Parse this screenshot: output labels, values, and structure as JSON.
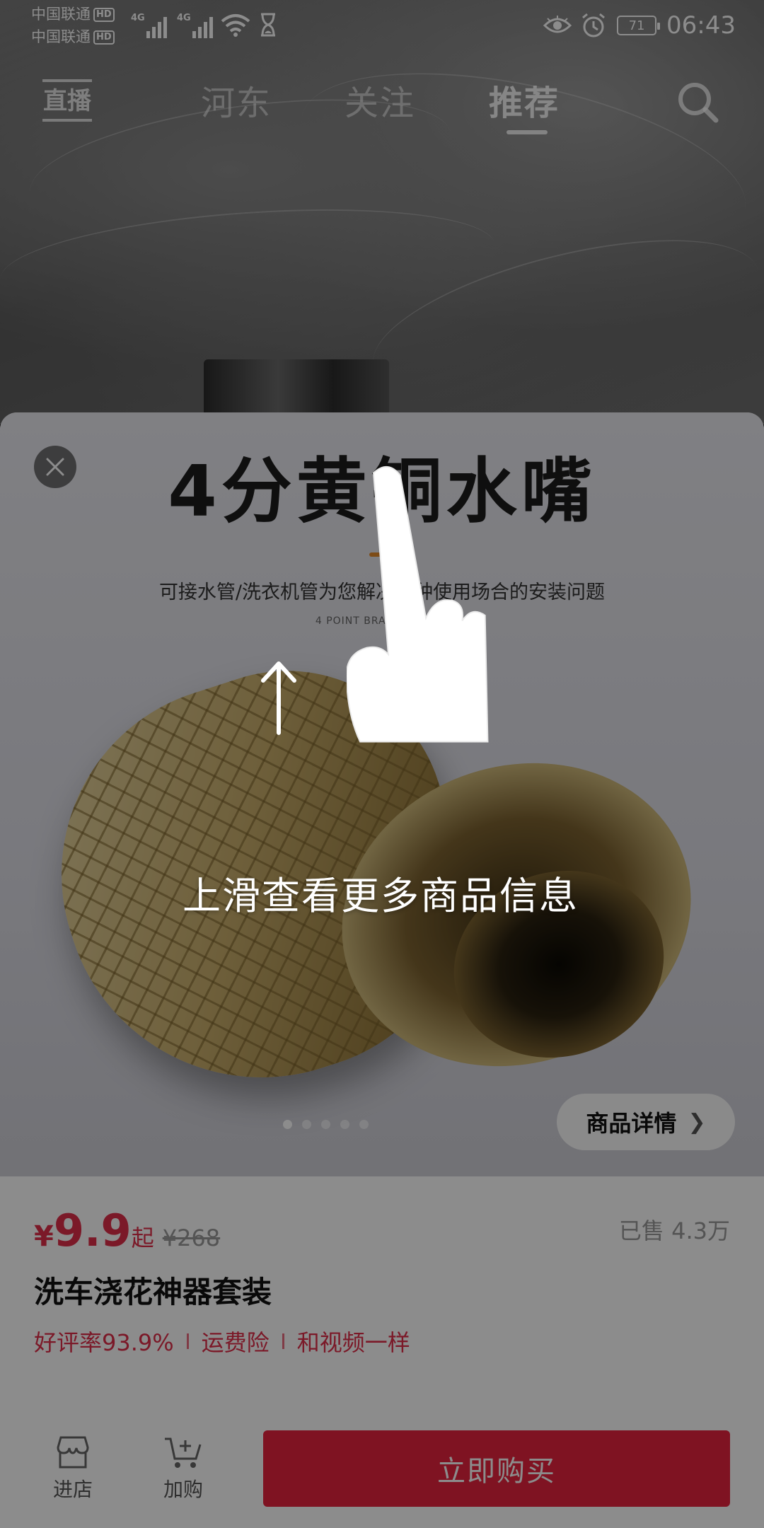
{
  "status_bar": {
    "carrier1": "中国联通",
    "carrier2": "中国联通",
    "hd_badge": "HD",
    "network1": "4G",
    "network2": "4G",
    "battery": "71",
    "time": "06:43"
  },
  "top_nav": {
    "live_label": "直播",
    "tabs": [
      {
        "label": "河东"
      },
      {
        "label": "关注"
      },
      {
        "label": "推荐"
      }
    ],
    "active_tab": "推荐"
  },
  "product": {
    "image_title": "4分黄铜水嘴",
    "image_subtitle": "可接水管/洗衣机管为您解决各种使用场合的安装问题",
    "image_english": "4 POINT BRASS NOZZLE",
    "carousel_count": 5,
    "carousel_active": 1,
    "detail_button": "商品详情",
    "price_symbol": "¥",
    "price": "9.9",
    "price_suffix": "起",
    "original_price": "¥268",
    "sold": "已售 4.3万",
    "name": "洗车浇花神器套装",
    "tags": [
      "好评率93.9%",
      "运费险",
      "和视频一样"
    ]
  },
  "bottom_bar": {
    "store_label": "进店",
    "cart_label": "加购",
    "buy_label": "立即购买"
  },
  "guide": {
    "text": "上滑查看更多商品信息"
  },
  "colors": {
    "accent_red": "#e8233e",
    "price_red": "#e02e4a",
    "nozzle_accent": "#e48a2b"
  },
  "icons": {
    "close": "close-icon",
    "search": "search-icon",
    "store": "store-icon",
    "cart": "cart-add-icon",
    "chevron": "chevron-right-icon",
    "hand": "pointing-hand-icon",
    "arrow": "arrow-up-icon"
  }
}
